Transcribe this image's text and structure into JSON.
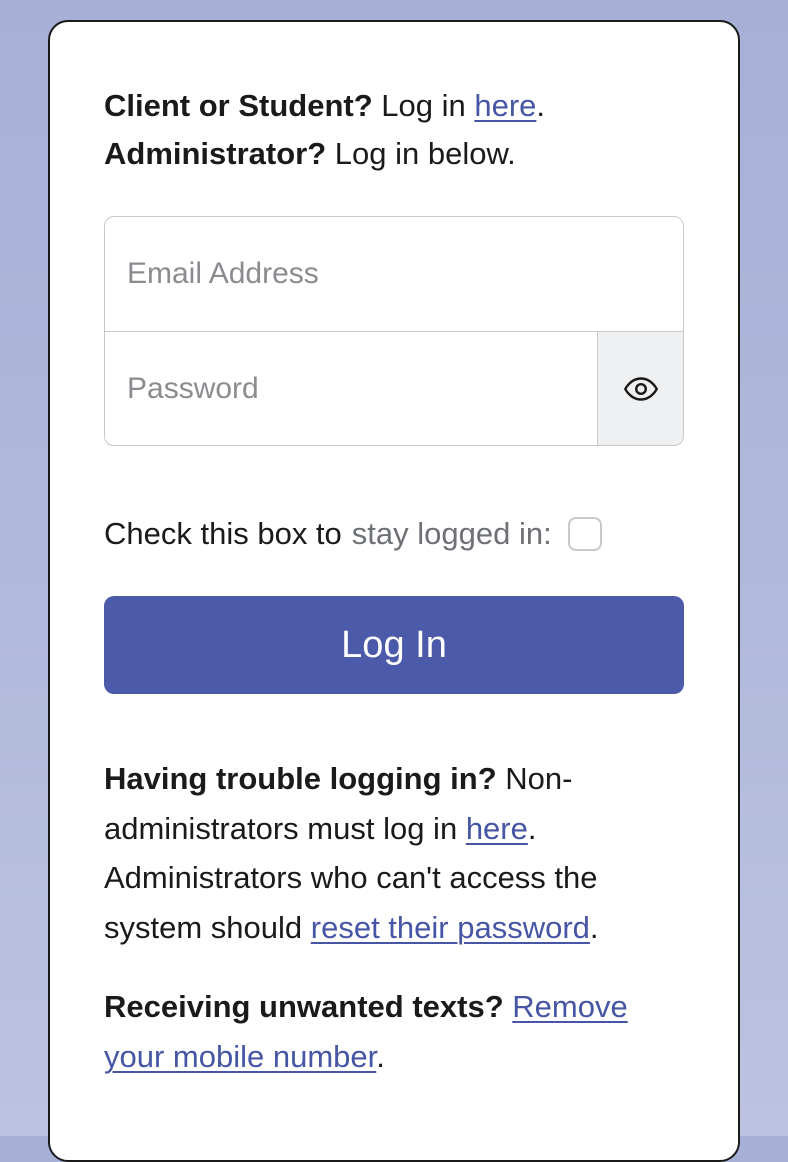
{
  "intro": {
    "client_bold": "Client or Student?",
    "client_text": " Log in ",
    "client_link": "here",
    "admin_bold": "Administrator?",
    "admin_text": " Log in below."
  },
  "form": {
    "email_placeholder": "Email Address",
    "password_placeholder": "Password"
  },
  "stay": {
    "prefix": "Check this box to ",
    "grey": "stay logged in:"
  },
  "button": {
    "login": "Log In"
  },
  "trouble": {
    "bold": "Having trouble logging in?",
    "text1": " Non-administrators must log in ",
    "link1": "here",
    "period1": ". Administrators who can't access the system should ",
    "link2": "reset their password",
    "period2": "."
  },
  "texts": {
    "bold": "Receiving unwanted texts?",
    "space": " ",
    "link": "Remove your mobile number",
    "period": "."
  }
}
